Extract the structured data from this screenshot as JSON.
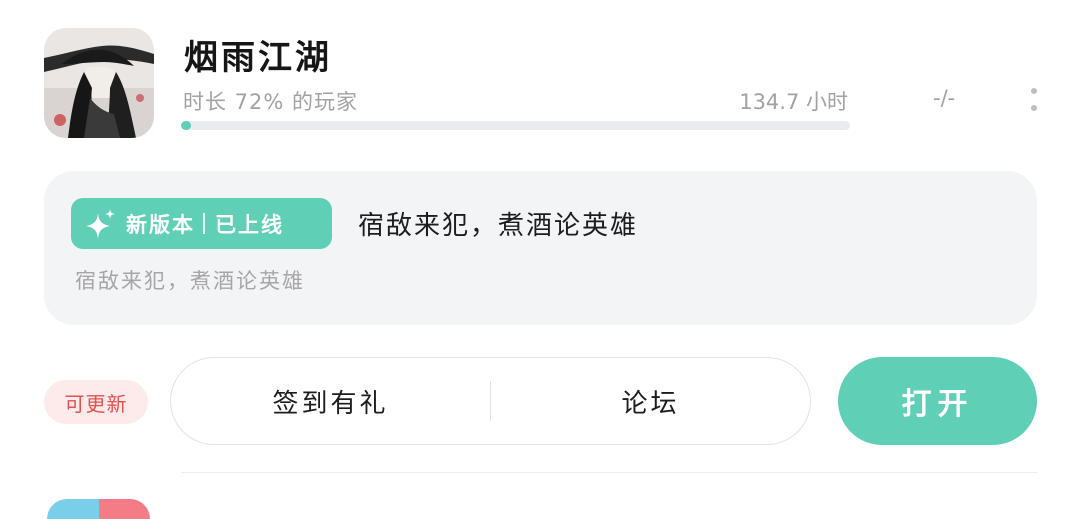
{
  "game": {
    "title": "烟雨江湖",
    "playtime_rank": "时长 72% 的玩家",
    "playtime_hours": "134.7 小时",
    "rating": "-/-",
    "progress_percent": 1.5,
    "icon": "game-artwork-icon"
  },
  "update": {
    "badge_new_version": "新版本",
    "badge_status": "已上线",
    "badge_icon": "sparkle-icon",
    "title": "宿敌来犯，煮酒论英雄",
    "description": "宿敌来犯，煮酒论英雄"
  },
  "actions": {
    "updatable_label": "可更新",
    "checkin_label": "签到有礼",
    "forum_label": "论坛",
    "open_label": "打开"
  },
  "colors": {
    "accent": "#5fcfb5",
    "updatable_text": "#e0534f",
    "updatable_bg": "#fdeaea",
    "card_bg": "#f3f4f6"
  }
}
